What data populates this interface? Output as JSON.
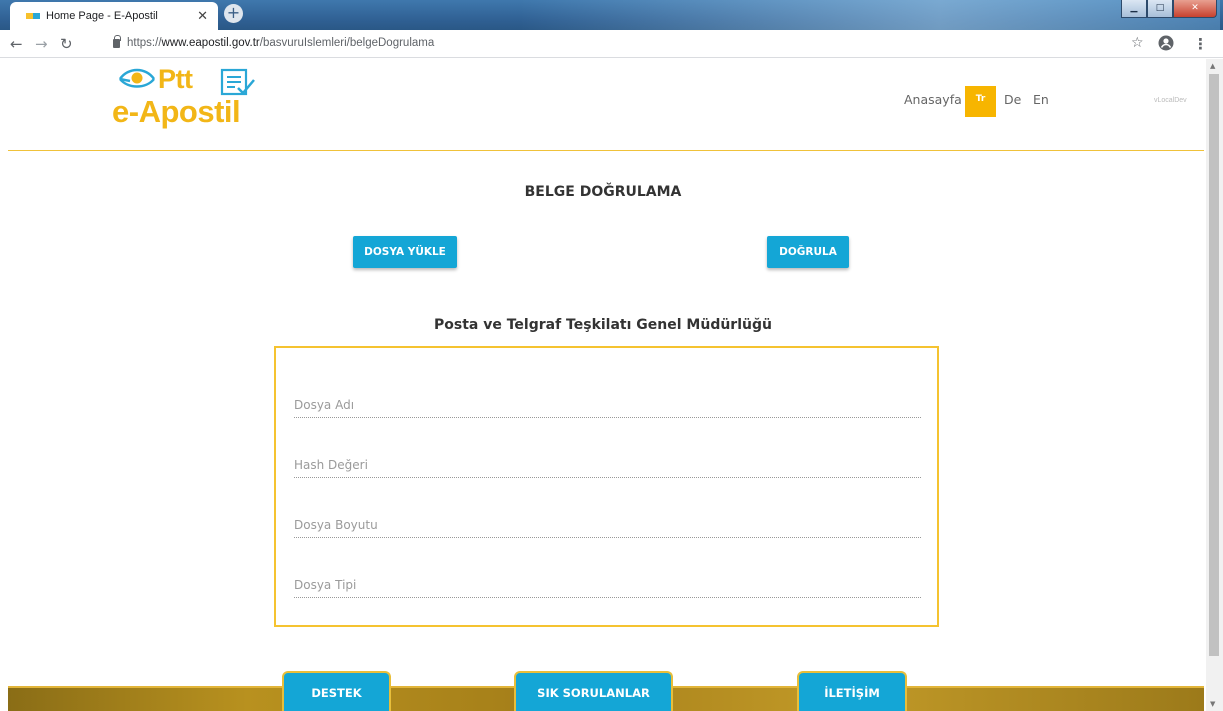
{
  "browser": {
    "tab_title": "Home Page - E-Apostil",
    "url_prefix": "https://",
    "url_host": "www.eapostil.gov.tr",
    "url_path": "/basvuruIslemleri/belgeDogrulama"
  },
  "header": {
    "logo_top": "Ptt",
    "logo_main": "e-Apostil",
    "nav_home": "Anasayfa",
    "lang_tr": "Tr",
    "lang_de": "De",
    "lang_en": "En",
    "version": "vLocalDev"
  },
  "main": {
    "title": "BELGE DOĞRULAMA",
    "upload_button": "DOSYA YÜKLE",
    "verify_button": "DOĞRULA",
    "organization": "Posta ve Telgraf Teşkilatı Genel Müdürlüğü",
    "fields": {
      "file_name": "Dosya Adı",
      "hash_value": "Hash Değeri",
      "file_size": "Dosya Boyutu",
      "file_type": "Dosya Tipi"
    }
  },
  "footer": {
    "support": "DESTEK",
    "faq": "SIK SORULANLAR",
    "contact": "İLETİŞİM"
  },
  "colors": {
    "accent_blue": "#14a6d6",
    "brand_yellow": "#f2b617",
    "panel_border": "#f5c330"
  }
}
